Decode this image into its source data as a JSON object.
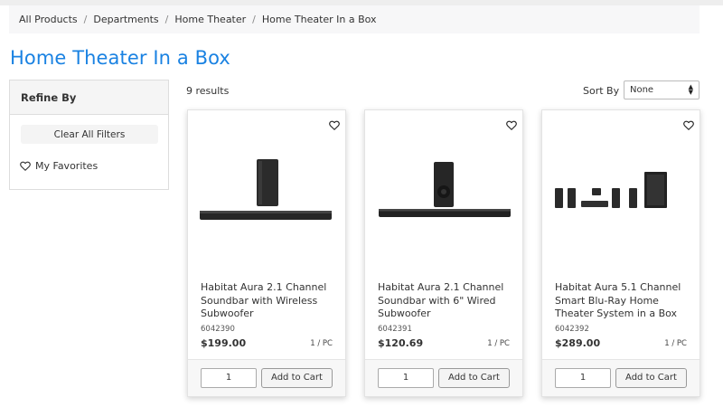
{
  "breadcrumb": [
    "All Products",
    "Departments",
    "Home Theater",
    "Home Theater In a Box"
  ],
  "page_title": "Home Theater In a Box",
  "sidebar": {
    "title": "Refine By",
    "clear_filters": "Clear All Filters",
    "favorites": "My Favorites"
  },
  "results_count": "9 results",
  "sort": {
    "label": "Sort By",
    "value": "None"
  },
  "products": [
    {
      "name": "Habitat Aura 2.1 Channel Soundbar with Wireless Subwoofer",
      "sku": "6042390",
      "price": "$199.00",
      "unit": "1 / PC",
      "qty": "1",
      "add_label": "Add to Cart"
    },
    {
      "name": "Habitat Aura 2.1 Channel Soundbar with 6\" Wired Subwoofer",
      "sku": "6042391",
      "price": "$120.69",
      "unit": "1 / PC",
      "qty": "1",
      "add_label": "Add to Cart"
    },
    {
      "name": "Habitat Aura 5.1 Channel Smart Blu-Ray Home Theater System in a Box",
      "sku": "6042392",
      "price": "$289.00",
      "unit": "1 / PC",
      "qty": "1",
      "add_label": "Add to Cart"
    }
  ],
  "colors": {
    "title_blue": "#1a82e2",
    "product_dark": "#2b2b2b"
  },
  "icons": [
    "heart-outline-icon",
    "sort-arrows-icon"
  ]
}
